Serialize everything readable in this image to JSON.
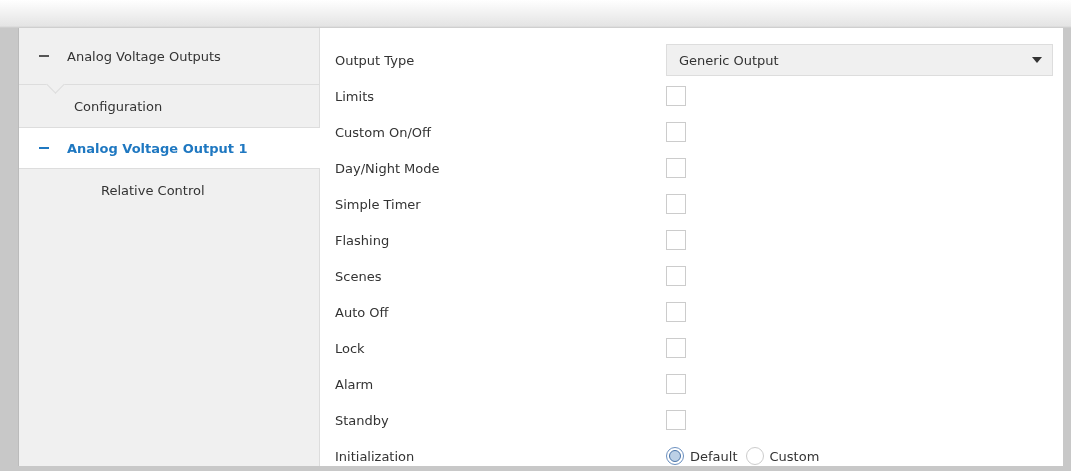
{
  "sidebar": {
    "header": {
      "label": "Analog Voltage Outputs",
      "expanded": true
    },
    "items": [
      {
        "label": "Configuration",
        "selected": false
      },
      {
        "label": "Analog Voltage Output 1",
        "selected": true,
        "expanded": true,
        "children": [
          {
            "label": "Relative Control",
            "selected": false
          }
        ]
      }
    ]
  },
  "form": {
    "rows": [
      {
        "kind": "dropdown",
        "label": "Output Type",
        "value": "Generic Output"
      },
      {
        "kind": "checkbox",
        "label": "Limits",
        "checked": false
      },
      {
        "kind": "checkbox",
        "label": "Custom On/Off",
        "checked": false
      },
      {
        "kind": "checkbox",
        "label": "Day/Night Mode",
        "checked": false
      },
      {
        "kind": "checkbox",
        "label": "Simple Timer",
        "checked": false
      },
      {
        "kind": "checkbox",
        "label": "Flashing",
        "checked": false
      },
      {
        "kind": "checkbox",
        "label": "Scenes",
        "checked": false
      },
      {
        "kind": "checkbox",
        "label": "Auto Off",
        "checked": false
      },
      {
        "kind": "checkbox",
        "label": "Lock",
        "checked": false
      },
      {
        "kind": "checkbox",
        "label": "Alarm",
        "checked": false
      },
      {
        "kind": "checkbox",
        "label": "Standby",
        "checked": false
      },
      {
        "kind": "radio",
        "label": "Initialization",
        "options": [
          {
            "label": "Default",
            "selected": true
          },
          {
            "label": "Custom",
            "selected": false
          }
        ]
      }
    ]
  }
}
